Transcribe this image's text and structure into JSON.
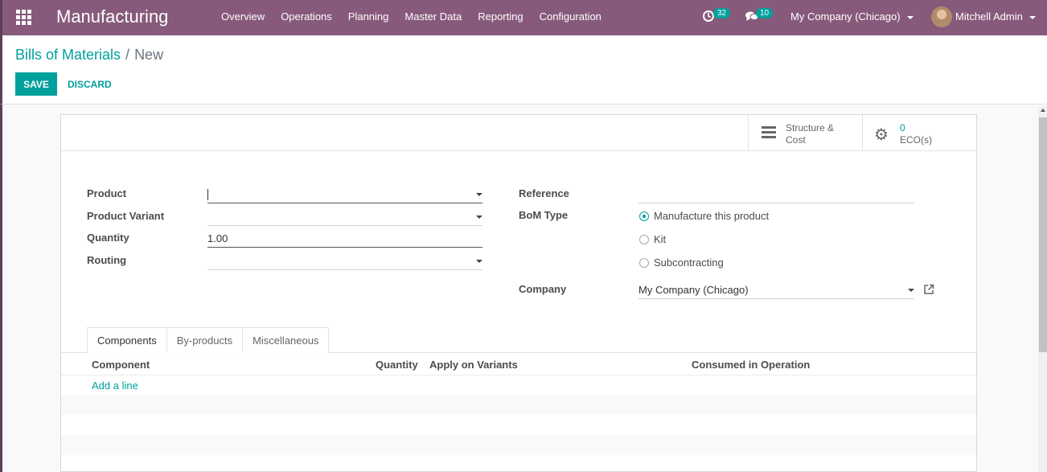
{
  "navbar": {
    "apps_icon": "apps-grid-icon",
    "brand": "Manufacturing",
    "menu": [
      "Overview",
      "Operations",
      "Planning",
      "Master Data",
      "Reporting",
      "Configuration"
    ],
    "activity_count": "32",
    "message_count": "10",
    "company": "My Company (Chicago)",
    "user": "Mitchell Admin",
    "color": "#875a7b"
  },
  "control": {
    "breadcrumb_parent": "Bills of Materials",
    "breadcrumb_sep": "/",
    "breadcrumb_current": "New",
    "save_label": "SAVE",
    "discard_label": "DISCARD"
  },
  "buttons": {
    "structure_line1": "Structure &",
    "structure_line2": "Cost",
    "eco_count": "0",
    "eco_label": "ECO(s)"
  },
  "form": {
    "product_label": "Product",
    "product_value": "",
    "variant_label": "Product Variant",
    "variant_value": "",
    "quantity_label": "Quantity",
    "quantity_value": "1.00",
    "routing_label": "Routing",
    "routing_value": "",
    "reference_label": "Reference",
    "reference_value": "",
    "bom_type_label": "BoM Type",
    "bom_types": [
      "Manufacture this product",
      "Kit",
      "Subcontracting"
    ],
    "bom_type_selected": "Manufacture this product",
    "company_label": "Company",
    "company_value": "My Company (Chicago)"
  },
  "tabs": [
    "Components",
    "By-products",
    "Miscellaneous"
  ],
  "table": {
    "columns": [
      "Component",
      "Quantity",
      "Apply on Variants",
      "Consumed in Operation"
    ],
    "add_line": "Add a line"
  },
  "accent": "#00a09d"
}
